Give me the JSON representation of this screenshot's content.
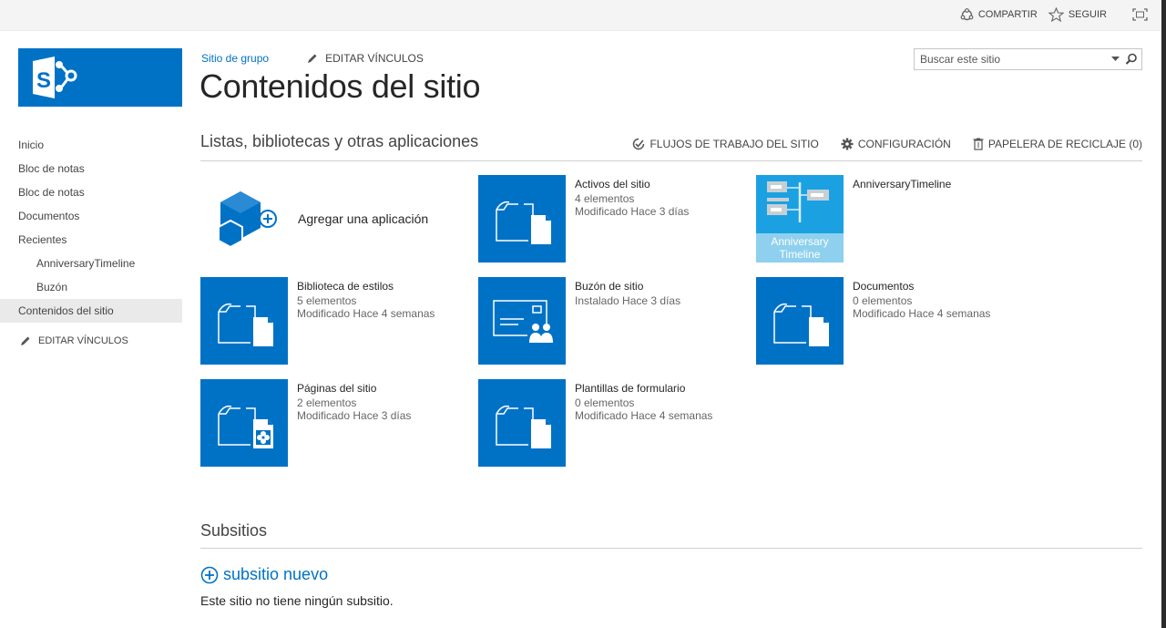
{
  "suite_bar": {
    "share_label": "COMPARTIR",
    "follow_label": "SEGUIR"
  },
  "header": {
    "breadcrumb": "Sitio de grupo",
    "edit_links": "EDITAR VÍNCULOS",
    "page_title": "Contenidos del sitio",
    "search_placeholder": "Buscar este sitio"
  },
  "quick_launch": {
    "items": [
      {
        "label": "Inicio"
      },
      {
        "label": "Bloc de notas"
      },
      {
        "label": "Bloc de notas"
      },
      {
        "label": "Documentos"
      },
      {
        "label": "Recientes"
      },
      {
        "label": "AnniversaryTimeline"
      },
      {
        "label": "Buzón"
      },
      {
        "label": "Contenidos del sitio"
      }
    ],
    "edit_links": "EDITAR VÍNCULOS"
  },
  "apps_section": {
    "title": "Listas, bibliotecas y otras aplicaciones",
    "workflows_label": "FLUJOS DE TRABAJO DEL SITIO",
    "settings_label": "CONFIGURACIÓN",
    "recycle_label": "PAPELERA DE RECICLAJE (0)"
  },
  "tiles": {
    "add_app": "Agregar una aplicación",
    "site_assets": {
      "name": "Activos del sitio",
      "count": "4 elementos",
      "modified": "Modificado Hace 3 días"
    },
    "timeline": {
      "name": "AnniversaryTimeline",
      "caption_line1": "Anniversary",
      "caption_line2": "Timeline"
    },
    "style_library": {
      "name": "Biblioteca de estilos",
      "count": "5 elementos",
      "modified": "Modificado Hace 4 semanas"
    },
    "site_mailbox": {
      "name": "Buzón de sitio",
      "installed": "Instalado Hace 3 días"
    },
    "documents": {
      "name": "Documentos",
      "count": "0 elementos",
      "modified": "Modificado Hace 4 semanas"
    },
    "site_pages": {
      "name": "Páginas del sitio",
      "count": "2 elementos",
      "modified": "Modificado Hace 3 días"
    },
    "form_templates": {
      "name": "Plantillas de formulario",
      "count": "0 elementos",
      "modified": "Modificado Hace 4 semanas"
    }
  },
  "subsites": {
    "title": "Subsitios",
    "new_label": "subsitio nuevo",
    "empty_message": "Este sitio no tiene ningún subsitio."
  },
  "colors": {
    "accent": "#0072c6",
    "timeline_tile": "#1ba1e2",
    "timeline_caption": "#8fd0ee"
  }
}
